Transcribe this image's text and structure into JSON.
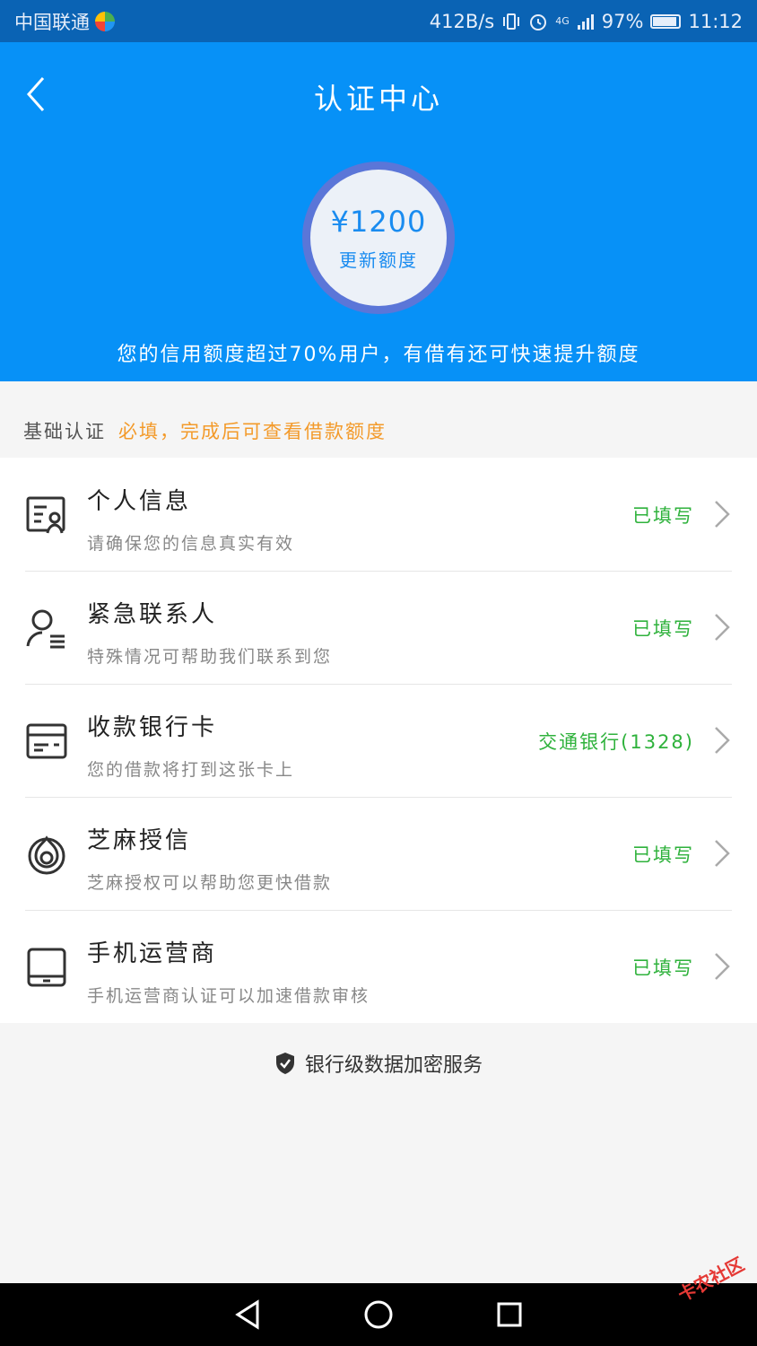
{
  "status_bar": {
    "carrier": "中国联通",
    "net_speed": "412B/s",
    "signal": "4G",
    "battery": "97%",
    "time": "11:12"
  },
  "header": {
    "title": "认证中心",
    "limit_amount": "¥1200",
    "limit_action": "更新额度",
    "tip": "您的信用额度超过70%用户，有借有还可快速提升额度",
    "bg_color": "#0791f7"
  },
  "section": {
    "title": "基础认证",
    "note": "必填，完成后可查看借款额度"
  },
  "items": [
    {
      "title": "个人信息",
      "desc": "请确保您的信息真实有效",
      "status": "已填写",
      "icon": "id-card-icon"
    },
    {
      "title": "紧急联系人",
      "desc": "特殊情况可帮助我们联系到您",
      "status": "已填写",
      "icon": "contact-icon"
    },
    {
      "title": "收款银行卡",
      "desc": "您的借款将打到这张卡上",
      "status": "交通银行(1328)",
      "icon": "bank-card-icon"
    },
    {
      "title": "芝麻授信",
      "desc": "芝麻授权可以帮助您更快借款",
      "status": "已填写",
      "icon": "sesame-icon"
    },
    {
      "title": "手机运营商",
      "desc": "手机运营商认证可以加速借款审核",
      "status": "已填写",
      "icon": "phone-icon"
    }
  ],
  "security_text": "银行级数据加密服务",
  "watermark": "卡农社区",
  "colors": {
    "status_green": "#2fb23c",
    "note_orange": "#f39a2a",
    "accent_blue": "#1a8cf0"
  }
}
